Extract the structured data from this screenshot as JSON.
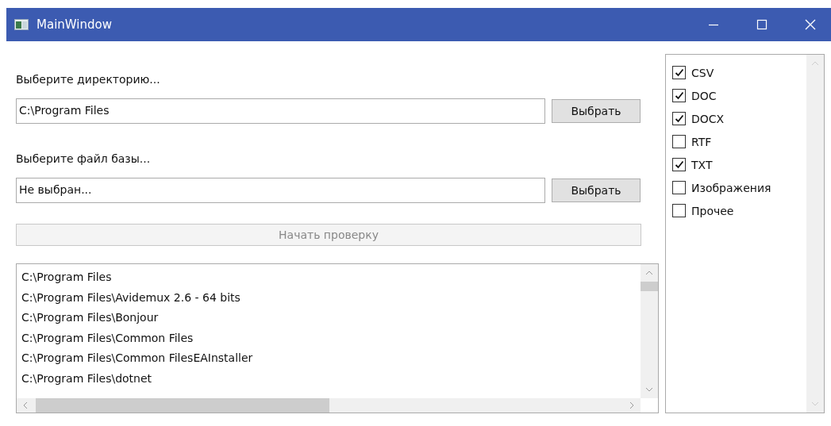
{
  "window": {
    "title": "MainWindow"
  },
  "directory": {
    "label": "Выберите директорию...",
    "value": "C:\\Program Files",
    "button": "Выбрать"
  },
  "database": {
    "label": "Выберите файл базы...",
    "value": "Не выбран...",
    "button": "Выбрать"
  },
  "start_button": {
    "label": "Начать проверку",
    "disabled": true
  },
  "paths": [
    "C:\\Program Files",
    "C:\\Program Files\\Avidemux 2.6 - 64 bits",
    "C:\\Program Files\\Bonjour",
    "C:\\Program Files\\Common Files",
    "C:\\Program Files\\Common FilesEAInstaller",
    "C:\\Program Files\\dotnet"
  ],
  "file_types": [
    {
      "label": "CSV",
      "checked": true
    },
    {
      "label": "DOC",
      "checked": true
    },
    {
      "label": "DOCX",
      "checked": true
    },
    {
      "label": "RTF",
      "checked": false
    },
    {
      "label": "TXT",
      "checked": true
    },
    {
      "label": "Изображения",
      "checked": false
    },
    {
      "label": "Прочее",
      "checked": false
    }
  ]
}
